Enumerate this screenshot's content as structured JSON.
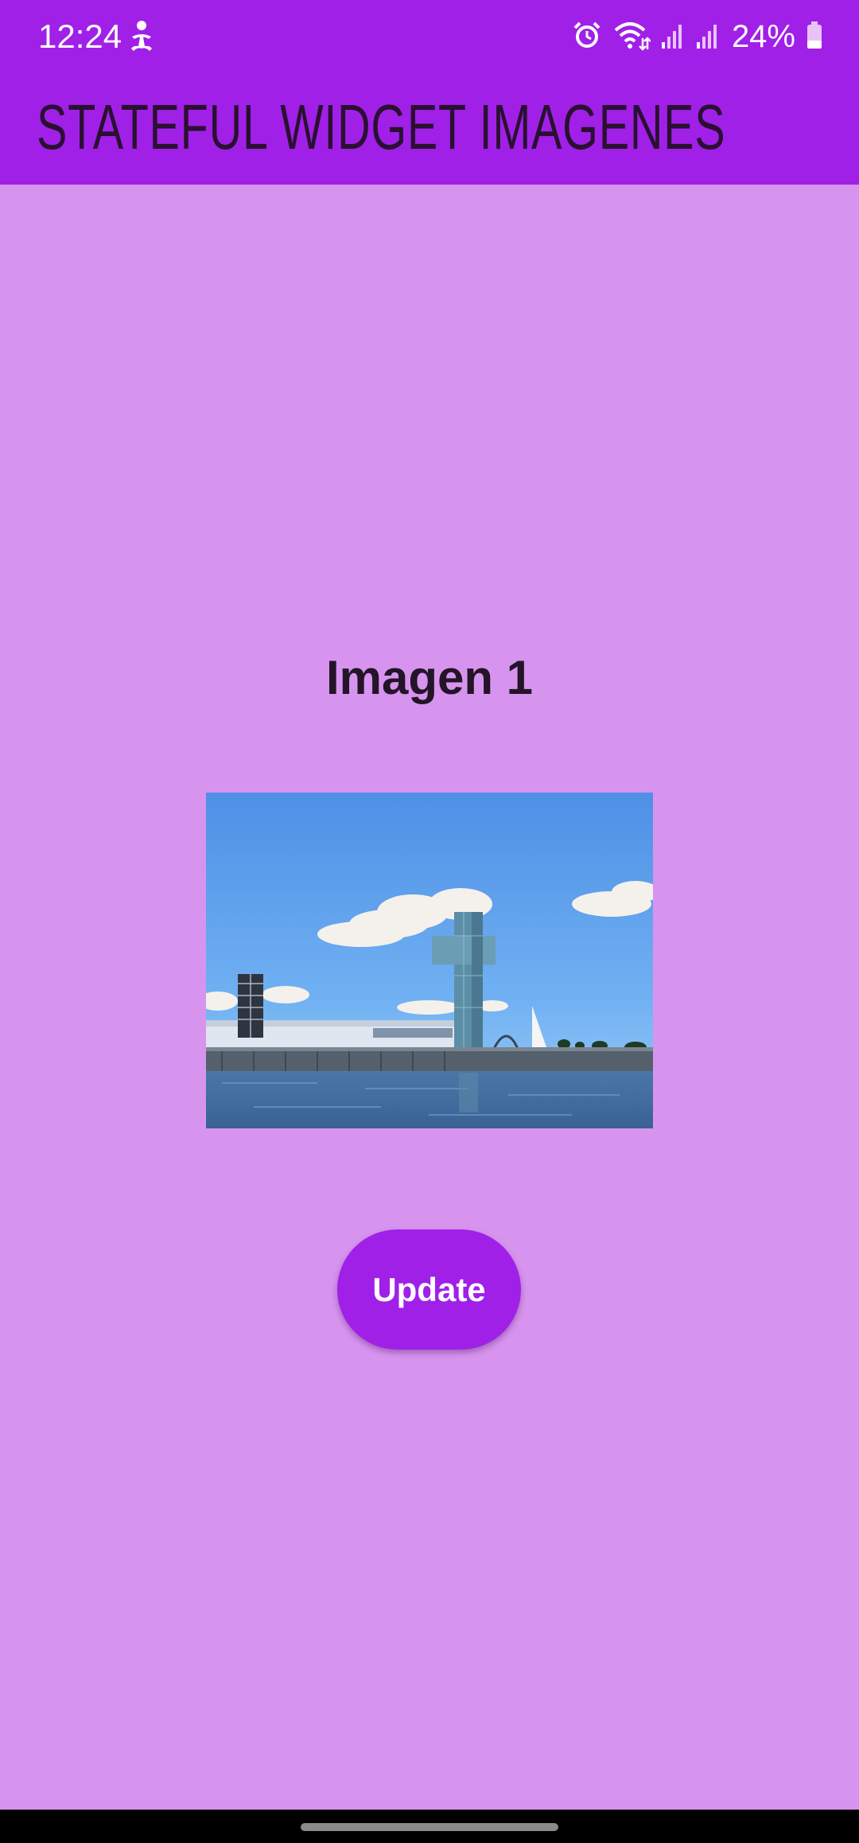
{
  "status_bar": {
    "time": "12:24",
    "battery": "24%",
    "icons": [
      "accessibility-icon",
      "alarm-icon",
      "wifi-icon",
      "signal-icon",
      "signal-icon-2",
      "battery-icon"
    ]
  },
  "app_bar": {
    "title": "STATEFUL WIDGET IMAGENES"
  },
  "content": {
    "image_title": "Imagen 1",
    "image_description": "waterfront-tower-photo",
    "update_label": "Update"
  },
  "colors": {
    "primary": "#a020e8",
    "background": "#d794ef",
    "text_dark": "#241428"
  }
}
